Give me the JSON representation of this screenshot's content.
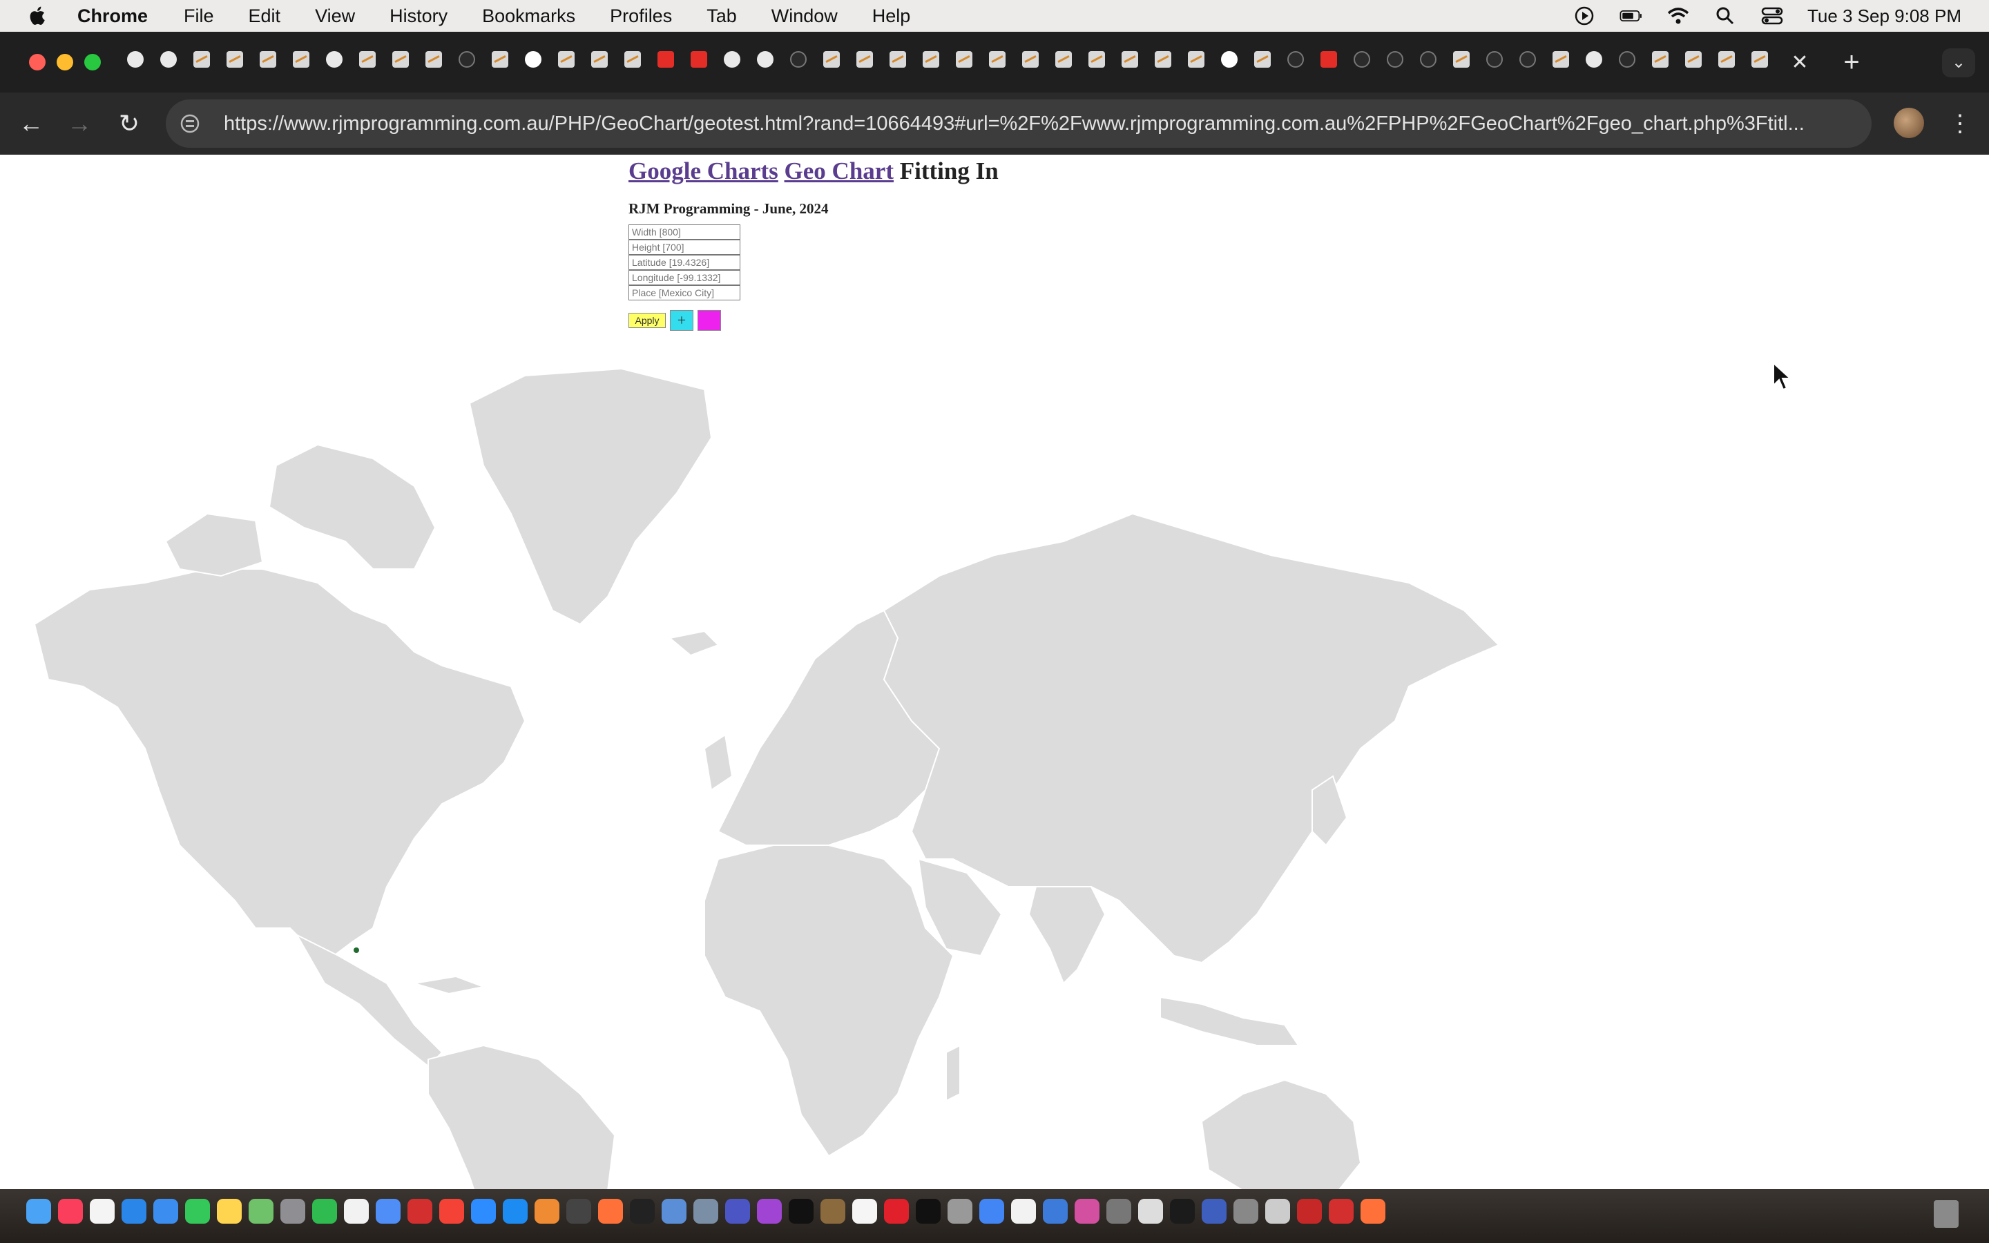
{
  "menubar": {
    "app_name": "Chrome",
    "items": [
      "File",
      "Edit",
      "View",
      "History",
      "Bookmarks",
      "Profiles",
      "Tab",
      "Window",
      "Help"
    ],
    "clock": "Tue 3 Sep  9:08 PM"
  },
  "browser": {
    "tab_close": "✕",
    "new_tab": "+",
    "url": "https://www.rjmprogramming.com.au/PHP/GeoChart/geotest.html?rand=10664493#url=%2F%2Fwww.rjmprogramming.com.au%2FPHP%2FGeoChart%2Fgeo_chart.php%3Ftitl..."
  },
  "page": {
    "title_link1": "Google Charts",
    "title_link2": "Geo Chart",
    "title_rest": "Fitting In",
    "subtitle": "RJM Programming - June, 2024",
    "fields": {
      "width": "Width [800]",
      "height": "Height [700]",
      "latitude": "Latitude [19.4326]",
      "longitude": "Longitude [-99.1332]",
      "place": "Place [Mexico City]"
    },
    "apply_label": "Apply",
    "plus_label": "+",
    "minus_label": ""
  },
  "map": {
    "land_color": "#dcdcdc",
    "border_color": "#ffffff",
    "marker_color": "#1f6b2e",
    "marker_place": "Mexico City"
  },
  "colors": {
    "link": "#5a3d8f",
    "apply_bg": "#ffff66",
    "plus_bg": "#33ddee",
    "minus_bg": "#ee22ee"
  }
}
